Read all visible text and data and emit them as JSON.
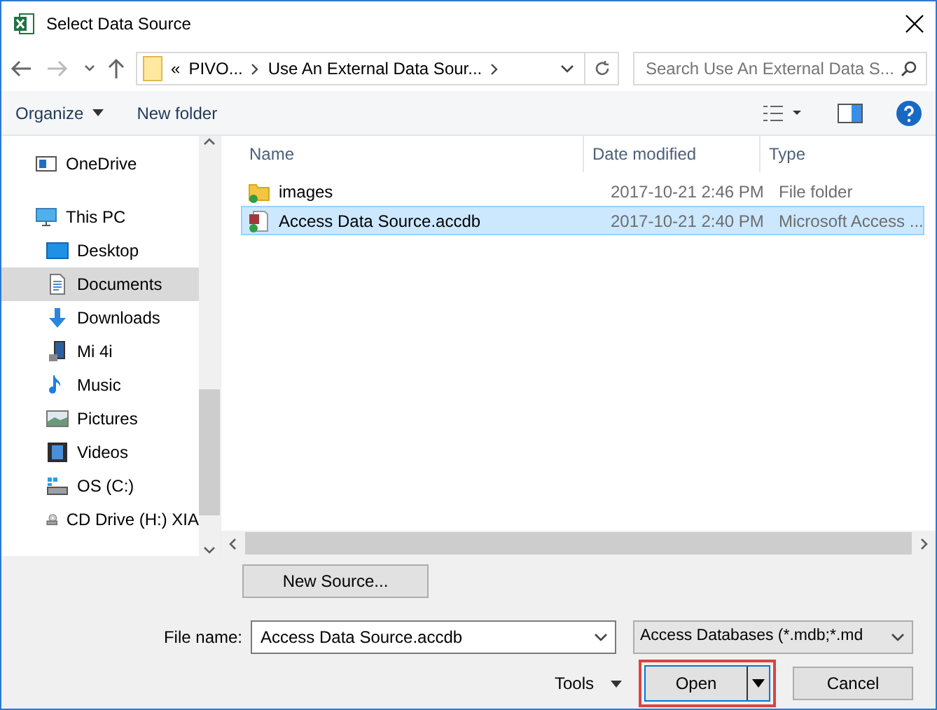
{
  "window": {
    "title": "Select Data Source"
  },
  "address_bar": {
    "prefix": "«",
    "segments": [
      "PIVO...",
      "Use An External Data Sour..."
    ]
  },
  "search": {
    "placeholder": "Search Use An External Data S..."
  },
  "toolbar": {
    "organize": "Organize",
    "new_folder": "New folder"
  },
  "sidebar": {
    "items": [
      {
        "label": "OneDrive",
        "kind": "cloud",
        "selected": false
      },
      {
        "label": "This PC",
        "kind": "pc",
        "selected": false,
        "children": [
          {
            "label": "Desktop",
            "kind": "desktop",
            "selected": false
          },
          {
            "label": "Documents",
            "kind": "documents",
            "selected": true
          },
          {
            "label": "Downloads",
            "kind": "downloads",
            "selected": false
          },
          {
            "label": "Mi 4i",
            "kind": "phone",
            "selected": false
          },
          {
            "label": "Music",
            "kind": "music",
            "selected": false
          },
          {
            "label": "Pictures",
            "kind": "pictures",
            "selected": false
          },
          {
            "label": "Videos",
            "kind": "videos",
            "selected": false
          },
          {
            "label": "OS (C:)",
            "kind": "drive",
            "selected": false
          },
          {
            "label": "CD Drive (H:) XIA",
            "kind": "cd",
            "selected": false
          }
        ]
      }
    ]
  },
  "table": {
    "columns": [
      "Name",
      "Date modified",
      "Type"
    ],
    "rows": [
      {
        "kind": "folder",
        "name": "images",
        "date": "2017-10-21 2:46 PM",
        "type": "File folder",
        "selected": false
      },
      {
        "kind": "database",
        "name": "Access Data Source.accdb",
        "date": "2017-10-21 2:40 PM",
        "type": "Microsoft Access ...",
        "selected": true
      }
    ]
  },
  "new_source_button": "New Source...",
  "file_name": {
    "label": "File name:",
    "value": "Access Data Source.accdb"
  },
  "file_type": "Access Databases (*.mdb;*.md",
  "tools": "Tools",
  "open_button": "Open",
  "cancel_button": "Cancel"
}
